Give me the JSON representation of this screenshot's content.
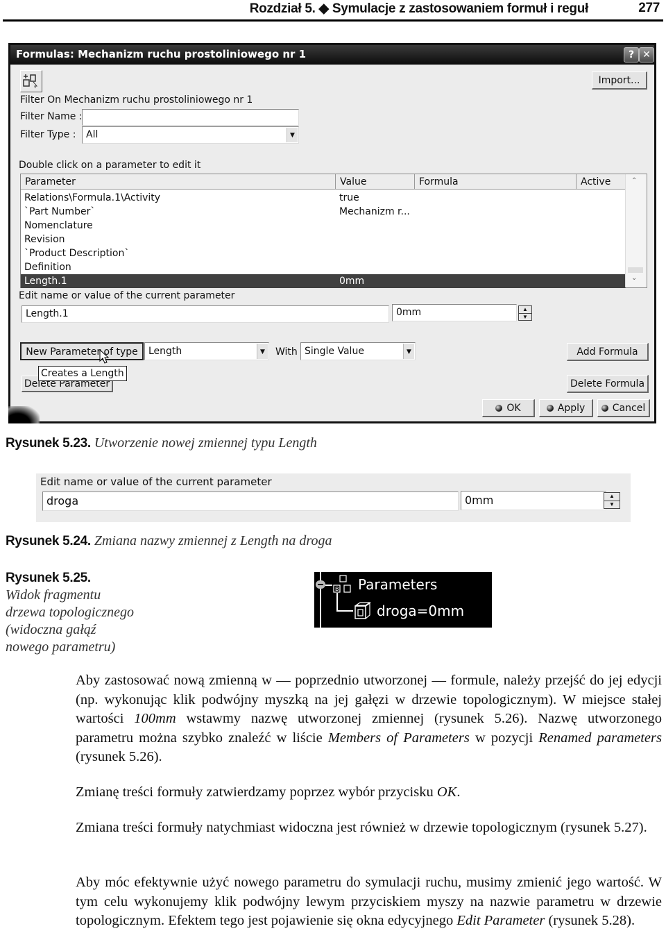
{
  "running_header": {
    "chapter": "Rozdział 5. ◆ Symulacje z zastosowaniem formuł i reguł",
    "page_number": "277"
  },
  "dialog": {
    "title": "Formulas: Mechanizm ruchu prostoliniowego nr 1",
    "help_icon": "?",
    "close_icon": "✕",
    "import_label": "Import...",
    "filter_on_label": "Filter On Mechanizm ruchu prostoliniowego nr 1",
    "filter_name_label": "Filter Name :",
    "filter_name_value": "",
    "filter_type_label": "Filter Type :",
    "filter_type_value": "All",
    "double_click_hint": "Double click on a parameter to edit it",
    "table": {
      "columns": [
        "Parameter",
        "Value",
        "Formula",
        "Active"
      ],
      "rows": [
        {
          "parameter": "Relations\\Formula.1\\Activity",
          "value": "true",
          "formula": "",
          "active": ""
        },
        {
          "parameter": "`Part Number`",
          "value": "Mechanizm r...",
          "formula": "",
          "active": ""
        },
        {
          "parameter": "Nomenclature",
          "value": "",
          "formula": "",
          "active": ""
        },
        {
          "parameter": "Revision",
          "value": "",
          "formula": "",
          "active": ""
        },
        {
          "parameter": "`Product Description`",
          "value": "",
          "formula": "",
          "active": ""
        },
        {
          "parameter": "Definition",
          "value": "",
          "formula": "",
          "active": ""
        },
        {
          "parameter": "Length.1",
          "value": "0mm",
          "formula": "",
          "active": "",
          "selected": true
        }
      ]
    },
    "edit_label": "Edit name or value of the current parameter",
    "edit_name_value": "Length.1",
    "edit_value_value": "0mm",
    "new_param_button": "New Parameter of type",
    "new_param_type": "Length",
    "with_label": "With",
    "with_value": "Single Value",
    "add_formula_button": "Add Formula",
    "delete_param_button": "Delete Parameter",
    "delete_formula_button": "Delete Formula",
    "tooltip": "Creates a Length",
    "ok_button": "OK",
    "apply_button": "Apply",
    "cancel_button": "Cancel"
  },
  "captions": {
    "fig23_num": "Rysunek 5.23.",
    "fig23_text": "Utworzenie nowej zmiennej typu Length",
    "fig24_num": "Rysunek 5.24.",
    "fig24_text": "Zmiana nazwy zmiennej z Length na droga",
    "fig25_num": "Rysunek 5.25.",
    "fig25_lines": [
      "Widok fragmentu",
      "drzewa topologicznego",
      "(widoczna gałąź",
      "nowego parametru)"
    ]
  },
  "fig24": {
    "edit_label": "Edit name or value of the current parameter",
    "name_value": "droga",
    "value_value": "0mm"
  },
  "fig25": {
    "parent_node": "Parameters",
    "child_node": "droga=0mm"
  },
  "body": {
    "p1_a": "Aby zastosować nową zmienną w — poprzednio utworzonej — formule, należy przejść do jej edycji (np. wykonując klik podwójny myszką na jej gałęzi w drzewie topologicznym). W miejsce stałej wartości ",
    "p1_i1": "100mm",
    "p1_b": " wstawmy nazwę utworzonej zmiennej (rysunek 5.26). Nazwę utworzonego parametru można szybko znaleźć w liście ",
    "p1_i2": "Members of Parameters",
    "p1_c": " w pozycji ",
    "p1_i3": "Renamed parameters",
    "p1_d": " (rysunek 5.26).",
    "p2_a": "Zmianę treści formuły zatwierdzamy poprzez wybór przycisku ",
    "p2_i": "OK",
    "p2_b": ".",
    "p3": "Zmiana treści formuły natychmiast widoczna jest również w drzewie topologicznym (rysunek 5.27).",
    "p4_a": "Aby móc efektywnie użyć nowego parametru do symulacji ruchu, musimy zmienić jego wartość. W tym celu wykonujemy klik podwójny lewym przyciskiem myszy na nazwie parametru w drzewie topologicznym. Efektem tego jest pojawienie się okna edycyjnego ",
    "p4_i": "Edit Parameter",
    "p4_b": " (rysunek 5.28)."
  }
}
